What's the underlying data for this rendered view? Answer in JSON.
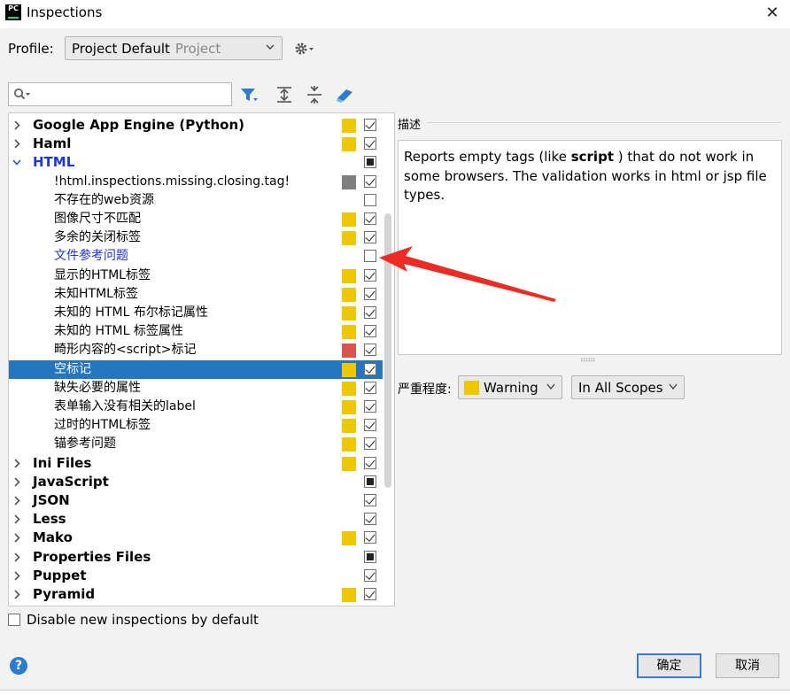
{
  "window": {
    "title": "Inspections",
    "close_glyph": "✕",
    "app_icon": "PC"
  },
  "profile": {
    "label": "Profile:",
    "value": "Project Default",
    "scope": "Project"
  },
  "search": {
    "placeholder": ""
  },
  "tree": {
    "rows": [
      {
        "label": "Google App Engine (Python)",
        "level": "group",
        "expanded": false,
        "severity": "#efc700",
        "check": "checked"
      },
      {
        "label": "Haml",
        "level": "group",
        "expanded": false,
        "severity": "#efc700",
        "check": "checked"
      },
      {
        "label": "HTML",
        "level": "group",
        "expanded": true,
        "blue": true,
        "severity": "",
        "check": "partial"
      },
      {
        "label": "!html.inspections.missing.closing.tag!",
        "level": "child",
        "severity": "#7f7f7f",
        "check": "checked"
      },
      {
        "label": "不存在的web资源",
        "level": "child",
        "severity": "",
        "check": "unchecked"
      },
      {
        "label": "图像尺寸不匹配",
        "level": "child",
        "severity": "#efc700",
        "check": "checked"
      },
      {
        "label": "多余的关闭标签",
        "level": "child",
        "severity": "#efc700",
        "check": "checked"
      },
      {
        "label": "文件参考问题",
        "level": "child",
        "blue": true,
        "severity": "",
        "check": "unchecked"
      },
      {
        "label": "显示的HTML标签",
        "level": "child",
        "severity": "#efc700",
        "check": "checked"
      },
      {
        "label": "未知HTML标签",
        "level": "child",
        "severity": "#efc700",
        "check": "checked"
      },
      {
        "label": "未知的 HTML 布尔标记属性",
        "level": "child",
        "severity": "#efc700",
        "check": "checked"
      },
      {
        "label": "未知的 HTML 标签属性",
        "level": "child",
        "severity": "#efc700",
        "check": "checked"
      },
      {
        "label": "畸形内容的<script>标记",
        "level": "child",
        "severity": "#d9534f",
        "check": "checked"
      },
      {
        "label": "空标记",
        "level": "child",
        "selected": true,
        "severity": "#efc700",
        "check": "checked"
      },
      {
        "label": "缺失必要的属性",
        "level": "child",
        "severity": "#efc700",
        "check": "checked"
      },
      {
        "label": "表单输入没有相关的label",
        "level": "child",
        "severity": "#efc700",
        "check": "checked"
      },
      {
        "label": "过时的HTML标签",
        "level": "child",
        "severity": "#efc700",
        "check": "checked"
      },
      {
        "label": "锚参考问题",
        "level": "child",
        "severity": "#efc700",
        "check": "checked"
      },
      {
        "label": "Ini Files",
        "level": "group",
        "expanded": false,
        "severity": "#efc700",
        "check": "checked"
      },
      {
        "label": "JavaScript",
        "level": "group",
        "expanded": false,
        "severity": "",
        "check": "partial"
      },
      {
        "label": "JSON",
        "level": "group",
        "expanded": false,
        "severity": "",
        "check": "checked"
      },
      {
        "label": "Less",
        "level": "group",
        "expanded": false,
        "severity": "",
        "check": "checked"
      },
      {
        "label": "Mako",
        "level": "group",
        "expanded": false,
        "severity": "#efc700",
        "check": "checked"
      },
      {
        "label": "Properties Files",
        "level": "group",
        "expanded": false,
        "severity": "",
        "check": "partial"
      },
      {
        "label": "Puppet",
        "level": "group",
        "expanded": false,
        "severity": "",
        "check": "checked"
      },
      {
        "label": "Pyramid",
        "level": "group",
        "expanded": false,
        "severity": "#efc700",
        "check": "checked"
      }
    ]
  },
  "disable_new": {
    "label": "Disable new inspections by default",
    "checked": false
  },
  "description": {
    "title": "描述",
    "before": "Reports empty tags (like ",
    "bold": "script",
    "after": " ) that do not work in some browsers. The validation works in html or jsp file types."
  },
  "severity": {
    "label": "严重程度:",
    "value": "Warning",
    "color": "#efc700"
  },
  "scope": {
    "value": "In All Scopes"
  },
  "buttons": {
    "help": "?",
    "ok": "确定",
    "cancel": "取消"
  },
  "colors": {
    "selection": "#2675bf",
    "annotation_arrow": "#ee2a24"
  }
}
